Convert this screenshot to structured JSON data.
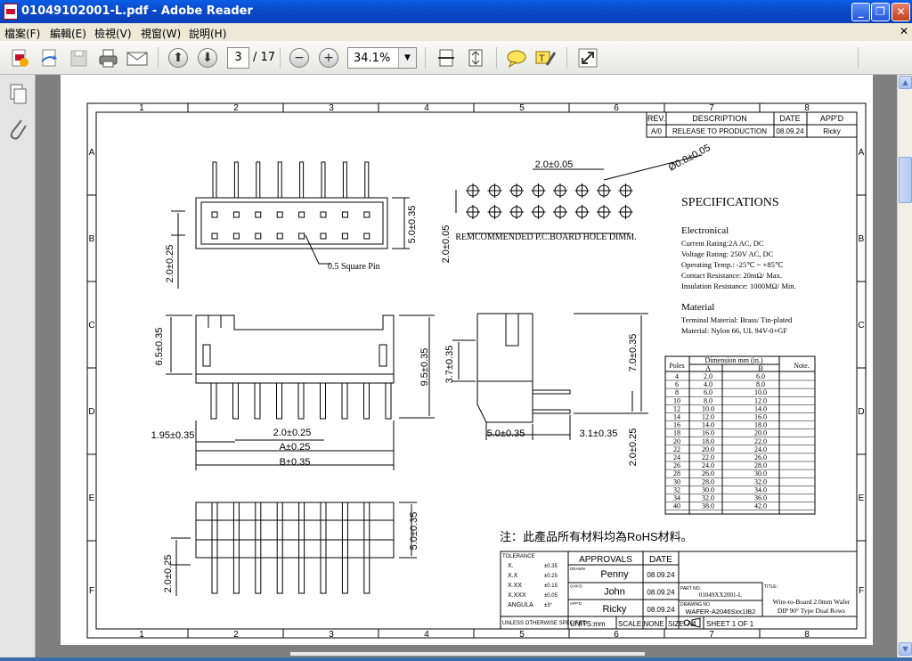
{
  "window": {
    "title": "01049102001-L.pdf - Adobe Reader"
  },
  "menu": [
    {
      "label": "檔案(F)"
    },
    {
      "label": "編輯(E)"
    },
    {
      "label": "檢視(V)"
    },
    {
      "label": "視窗(W)"
    },
    {
      "label": "說明(H)"
    }
  ],
  "toolbar": {
    "page_current": "3",
    "page_total": "/ 17",
    "zoom": "34.1%",
    "annotations": "注釋",
    "share": "共用"
  },
  "drawing": {
    "columns": [
      "1",
      "2",
      "3",
      "4",
      "5",
      "6",
      "7",
      "8"
    ],
    "rows": [
      "A",
      "B",
      "C",
      "D",
      "E",
      "F"
    ],
    "revision_headers": [
      "REV.",
      "DESCRIPTION",
      "DATE",
      "APP'D"
    ],
    "revision_row": [
      "A/0",
      "RELEASE TO PRODUCTION",
      "08.09.24",
      "Ricky"
    ],
    "dims": {
      "pitch_top": "2.0±0.05",
      "hole_dia": "Ø0.8±0.05",
      "hole_label": "REMCOMMENDED P.C.BOARD HOLE DIMM.",
      "pcb_row": "2.0±0.05",
      "front_height": "5.0±0.35",
      "front_row": "2.0±0.25",
      "square_pin": "0.5 Square Pin",
      "side_h1": "6.5±0.35",
      "side_h2": "9.5±0.35",
      "pitch": "2.0±0.25",
      "edge": "1.95±0.35",
      "a_dim": "A±0.25",
      "b_dim": "B±0.35",
      "side_h3": "3.7±0.35",
      "side_h4": "7.0±0.35",
      "side_w1": "5.0±0.35",
      "side_w2": "3.1±0.35",
      "side_row": "2.0±0.25",
      "bottom_h": "5.0±0.35",
      "bottom_row": "2.0±0.25"
    },
    "spec": {
      "title": "SPECIFICATIONS",
      "electrical_title": "Electronical",
      "electrical": [
        "Current Rating:2A AC, DC",
        "Voltage Rating: 250V AC, DC",
        "Operating Temp.: -25℃ ~ +85℃",
        "Contact Resistance: 20mΩ/ Max.",
        "Insulation Resistance: 1000MΩ/ Min."
      ],
      "material_title": "Material",
      "material": [
        "Terminal Material: Brass/ Tin-plated",
        "Material: Nylon 66, UL 94V-0+GF"
      ]
    },
    "dim_table": {
      "headers": [
        "Poles",
        "Dimension mm (in.)",
        "A",
        "B",
        "Note."
      ],
      "rows": [
        [
          "4",
          "2.0",
          "6.0"
        ],
        [
          "6",
          "4.0",
          "8.0"
        ],
        [
          "8",
          "6.0",
          "10.0"
        ],
        [
          "10",
          "8.0",
          "12.0"
        ],
        [
          "12",
          "10.0",
          "14.0"
        ],
        [
          "14",
          "12.0",
          "16.0"
        ],
        [
          "16",
          "14.0",
          "18.0"
        ],
        [
          "18",
          "16.0",
          "20.0"
        ],
        [
          "20",
          "18.0",
          "22.0"
        ],
        [
          "22",
          "20.0",
          "24.0"
        ],
        [
          "24",
          "22.0",
          "26.0"
        ],
        [
          "26",
          "24.0",
          "28.0"
        ],
        [
          "28",
          "26.0",
          "30.0"
        ],
        [
          "30",
          "28.0",
          "32.0"
        ],
        [
          "32",
          "30.0",
          "34.0"
        ],
        [
          "34",
          "32.0",
          "36.0"
        ],
        [
          "40",
          "38.0",
          "42.0"
        ]
      ]
    },
    "rohs_note": "注：此產品所有材料均為RoHS材料。",
    "title_block": {
      "tolerance": "TOLERANCE",
      "tol_rows": [
        [
          "X.",
          "±0.35"
        ],
        [
          "X.X",
          "±0.25"
        ],
        [
          "X.XX",
          "±0.15"
        ],
        [
          "X.XXX",
          "±0.05"
        ],
        [
          "ANGULA",
          "±3°"
        ]
      ],
      "unless": "UNLESS OTHERWISE SPECIFIED",
      "approvals": "APPROVALS",
      "date": "DATE",
      "people": [
        [
          "DRAWN",
          "Penny",
          "08.09.24"
        ],
        [
          "CHK'D",
          "John",
          "08.09.24"
        ],
        [
          "APP'D",
          "Ricky",
          "08.09.24"
        ]
      ],
      "units": "UNITS:mm",
      "scale": "SCALE:NONE",
      "size": "SIZE: A4",
      "sheet": "SHEET 1 OF 1",
      "part_no_lbl": "PART NO.",
      "part_no": "01049XX2001-L",
      "drawing_no_lbl": "DRAWING NO.",
      "drawing_no": "WAFER-A2046Sxx1IB2",
      "title_lbl": "TITLE:",
      "title_1": "Wire-to-Board 2.0mm Wafer",
      "title_2": "DIP 90° Type Dual Rows"
    }
  }
}
